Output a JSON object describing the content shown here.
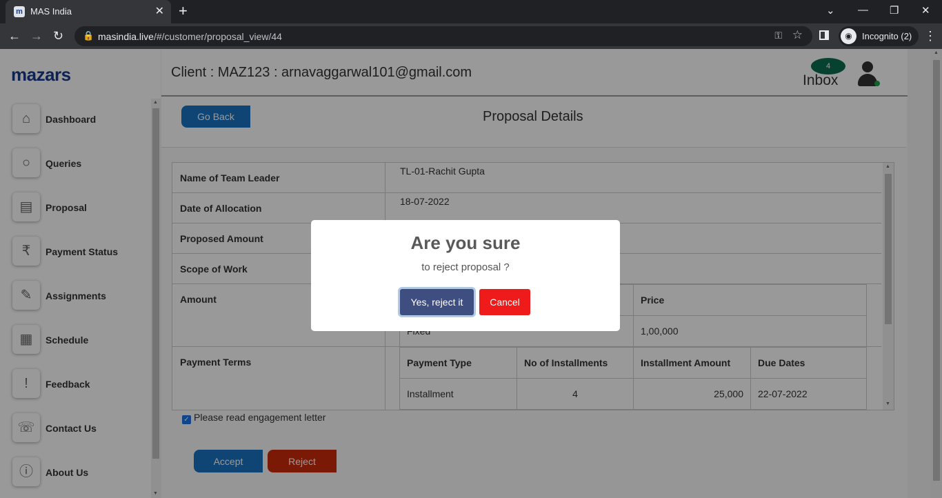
{
  "browser": {
    "tab_title": "MAS India",
    "favicon": "m",
    "url_host": "masindia.live",
    "url_path": "/#/customer/proposal_view/44",
    "incognito_label": "Incognito (2)"
  },
  "sidebar": {
    "logo": "mazars",
    "items": [
      {
        "label": "Dashboard",
        "icon": "home-icon"
      },
      {
        "label": "Queries",
        "icon": "search-icon"
      },
      {
        "label": "Proposal",
        "icon": "proposal-icon"
      },
      {
        "label": "Payment Status",
        "icon": "rupee-icon"
      },
      {
        "label": "Assignments",
        "icon": "assignment-icon"
      },
      {
        "label": "Schedule",
        "icon": "calendar-icon"
      },
      {
        "label": "Feedback",
        "icon": "feedback-icon"
      },
      {
        "label": "Contact Us",
        "icon": "contact-icon"
      },
      {
        "label": "About Us",
        "icon": "info-icon"
      }
    ]
  },
  "header": {
    "client": "Client : MAZ123 : arnavaggarwal101@gmail.com",
    "inbox_count": "4",
    "inbox_label": "Inbox"
  },
  "proposal": {
    "go_back": "Go Back",
    "title": "Proposal Details",
    "rows": [
      {
        "key": "Name of Team Leader",
        "value": "TL-01-Rachit Gupta"
      },
      {
        "key": "Date of Allocation",
        "value": "18-07-2022"
      },
      {
        "key": "Proposed Amount",
        "value": ""
      },
      {
        "key": "Scope of Work",
        "value": ""
      },
      {
        "key": "Amount",
        "value": ""
      },
      {
        "key": "Payment Terms",
        "value": ""
      }
    ],
    "amount_table": {
      "headers": [
        "",
        "Price"
      ],
      "row": [
        "Fixed",
        "1,00,000"
      ]
    },
    "payment_table": {
      "headers": [
        "Payment Type",
        "No of Installments",
        "Installment Amount",
        "Due Dates"
      ],
      "row": [
        "Installment",
        "4",
        "25,000",
        "22-07-2022"
      ]
    },
    "engagement_label": "Please read engagement letter",
    "accept": "Accept",
    "reject": "Reject"
  },
  "modal": {
    "title": "Are you sure",
    "text": "to reject proposal ?",
    "confirm": "Yes, reject it",
    "cancel": "Cancel"
  },
  "colors": {
    "brand": "#1a3a8c",
    "primary_button": "#1a73c4",
    "reject_button": "#cc2a0b",
    "confirm_button": "#3f4e80",
    "cancel_button": "#ef1b1b"
  }
}
